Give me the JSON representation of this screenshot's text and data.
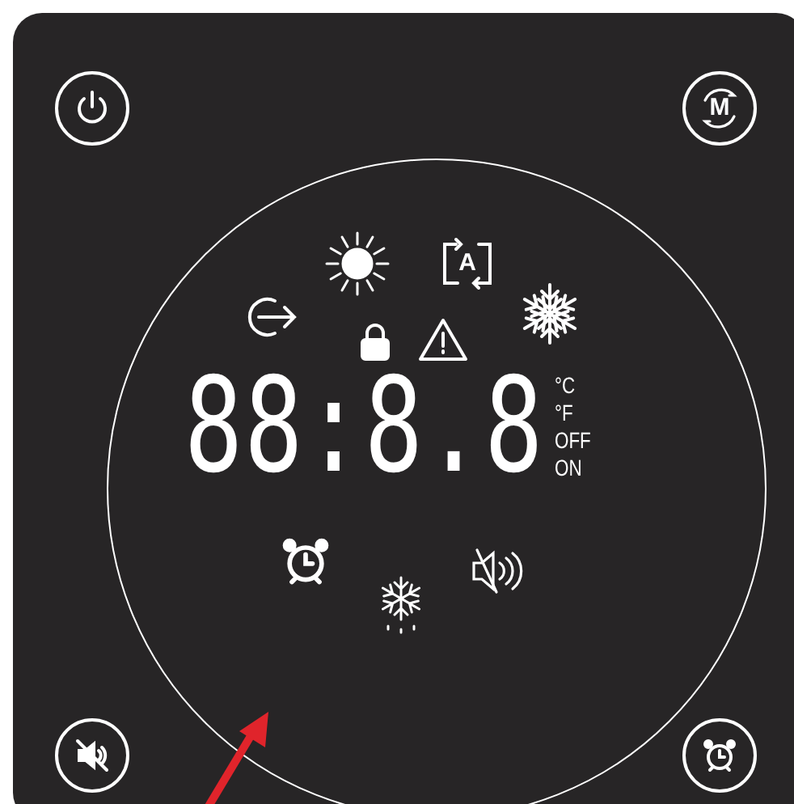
{
  "buttons": [
    {
      "kind": "power"
    },
    {
      "kind": "mode",
      "label": "M"
    },
    {
      "kind": "mute"
    },
    {
      "kind": "alarm"
    }
  ],
  "display": {
    "digits": "88:8.8",
    "auto_label": "A",
    "units": [
      "°C",
      "°F",
      "OFF",
      "ON"
    ]
  }
}
